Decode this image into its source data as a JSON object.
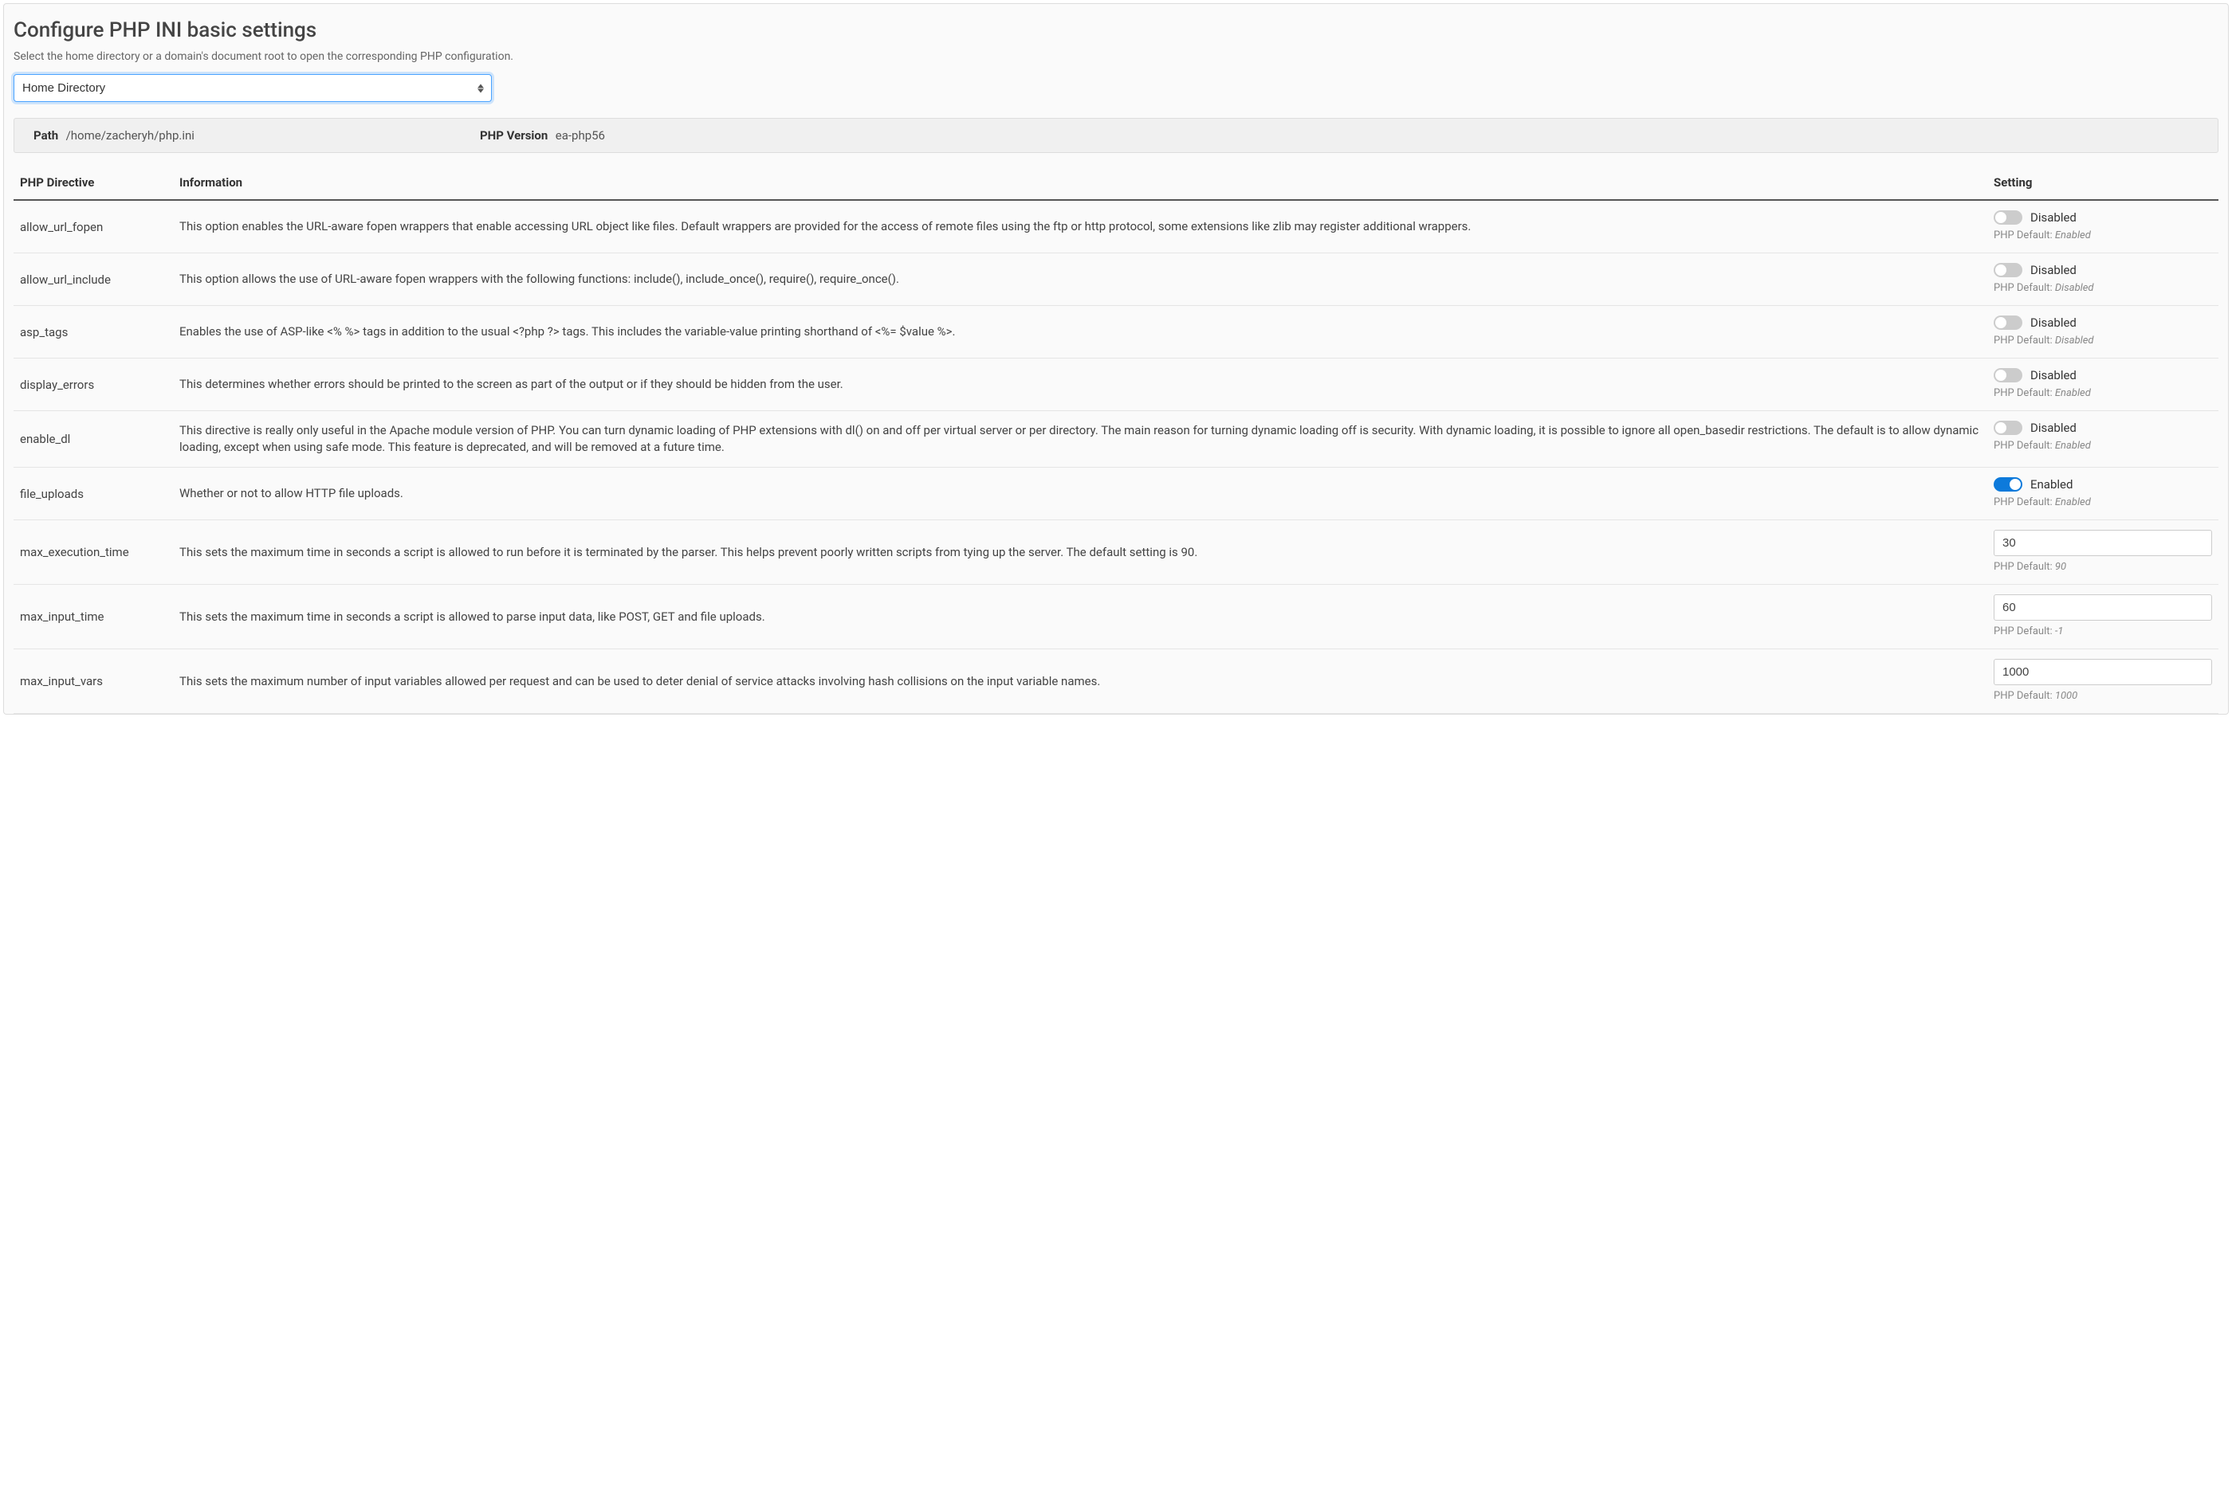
{
  "header": {
    "title": "Configure PHP INI basic settings",
    "subtitle": "Select the home directory or a domain's document root to open the corresponding PHP configuration."
  },
  "select": {
    "value": "Home Directory"
  },
  "infobar": {
    "path_label": "Path",
    "path_value": "/home/zacheryh/php.ini",
    "version_label": "PHP Version",
    "version_value": "ea-php56"
  },
  "columns": {
    "directive": "PHP Directive",
    "information": "Information",
    "setting": "Setting"
  },
  "labels": {
    "disabled": "Disabled",
    "enabled": "Enabled",
    "php_default_prefix": "PHP Default: "
  },
  "rows": [
    {
      "directive": "allow_url_fopen",
      "info": "This option enables the URL-aware fopen wrappers that enable accessing URL object like files. Default wrappers are provided for the access of remote files using the ftp or http protocol, some extensions like zlib may register additional wrappers.",
      "type": "toggle",
      "value": false,
      "default": "Enabled"
    },
    {
      "directive": "allow_url_include",
      "info": "This option allows the use of URL-aware fopen wrappers with the following functions: include(), include_once(), require(), require_once().",
      "type": "toggle",
      "value": false,
      "default": "Disabled"
    },
    {
      "directive": "asp_tags",
      "info": "Enables the use of ASP-like <% %> tags in addition to the usual <?php ?> tags. This includes the variable-value printing shorthand of <%= $value %>.",
      "type": "toggle",
      "value": false,
      "default": "Disabled"
    },
    {
      "directive": "display_errors",
      "info": "This determines whether errors should be printed to the screen as part of the output or if they should be hidden from the user.",
      "type": "toggle",
      "value": false,
      "default": "Enabled"
    },
    {
      "directive": "enable_dl",
      "info": "This directive is really only useful in the Apache module version of PHP. You can turn dynamic loading of PHP extensions with dl() on and off per virtual server or per directory. The main reason for turning dynamic loading off is security. With dynamic loading, it is possible to ignore all open_basedir restrictions. The default is to allow dynamic loading, except when using safe mode. This feature is deprecated, and will be removed at a future time.",
      "type": "toggle",
      "value": false,
      "default": "Enabled"
    },
    {
      "directive": "file_uploads",
      "info": "Whether or not to allow HTTP file uploads.",
      "type": "toggle",
      "value": true,
      "default": "Enabled"
    },
    {
      "directive": "max_execution_time",
      "info": "This sets the maximum time in seconds a script is allowed to run before it is terminated by the parser. This helps prevent poorly written scripts from tying up the server. The default setting is 90.",
      "type": "text",
      "value": "30",
      "default": "90"
    },
    {
      "directive": "max_input_time",
      "info": "This sets the maximum time in seconds a script is allowed to parse input data, like POST, GET and file uploads.",
      "type": "text",
      "value": "60",
      "default": "-1"
    },
    {
      "directive": "max_input_vars",
      "info": "This sets the maximum number of input variables allowed per request and can be used to deter denial of service attacks involving hash collisions on the input variable names.",
      "type": "text",
      "value": "1000",
      "default": "1000"
    }
  ]
}
